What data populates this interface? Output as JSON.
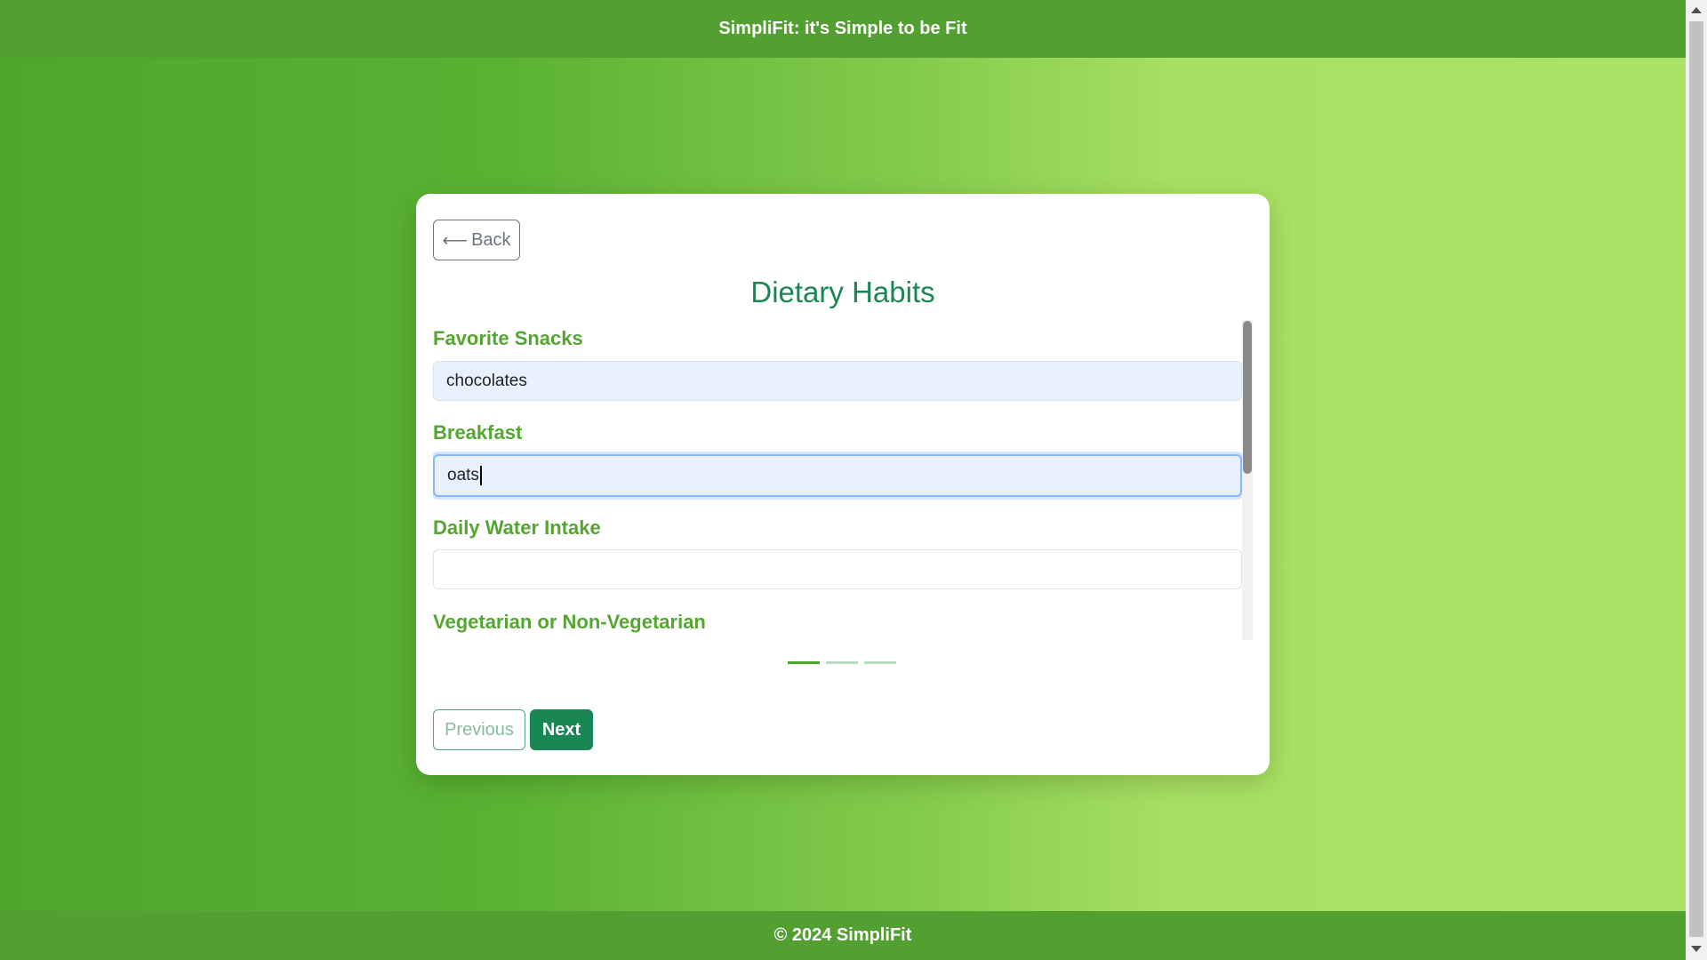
{
  "header": {
    "title": "SimpliFit: it's Simple to be Fit"
  },
  "footer": {
    "text": "© 2024 SimpliFit"
  },
  "card": {
    "back_label": "Back",
    "back_arrow": "⟵",
    "title": "Dietary Habits",
    "fields": [
      {
        "label": "Favorite Snacks",
        "value": "chocolates"
      },
      {
        "label": "Breakfast",
        "value": "oats"
      },
      {
        "label": "Daily Water Intake",
        "value": ""
      },
      {
        "label": "Vegetarian or Non-Vegetarian",
        "value": ""
      }
    ],
    "step_indicator": {
      "total": 3,
      "current": 1
    },
    "previous_label": "Previous",
    "next_label": "Next"
  },
  "colors": {
    "header_bg": "#539f32",
    "accent": "#198754",
    "label": "#55a630"
  }
}
